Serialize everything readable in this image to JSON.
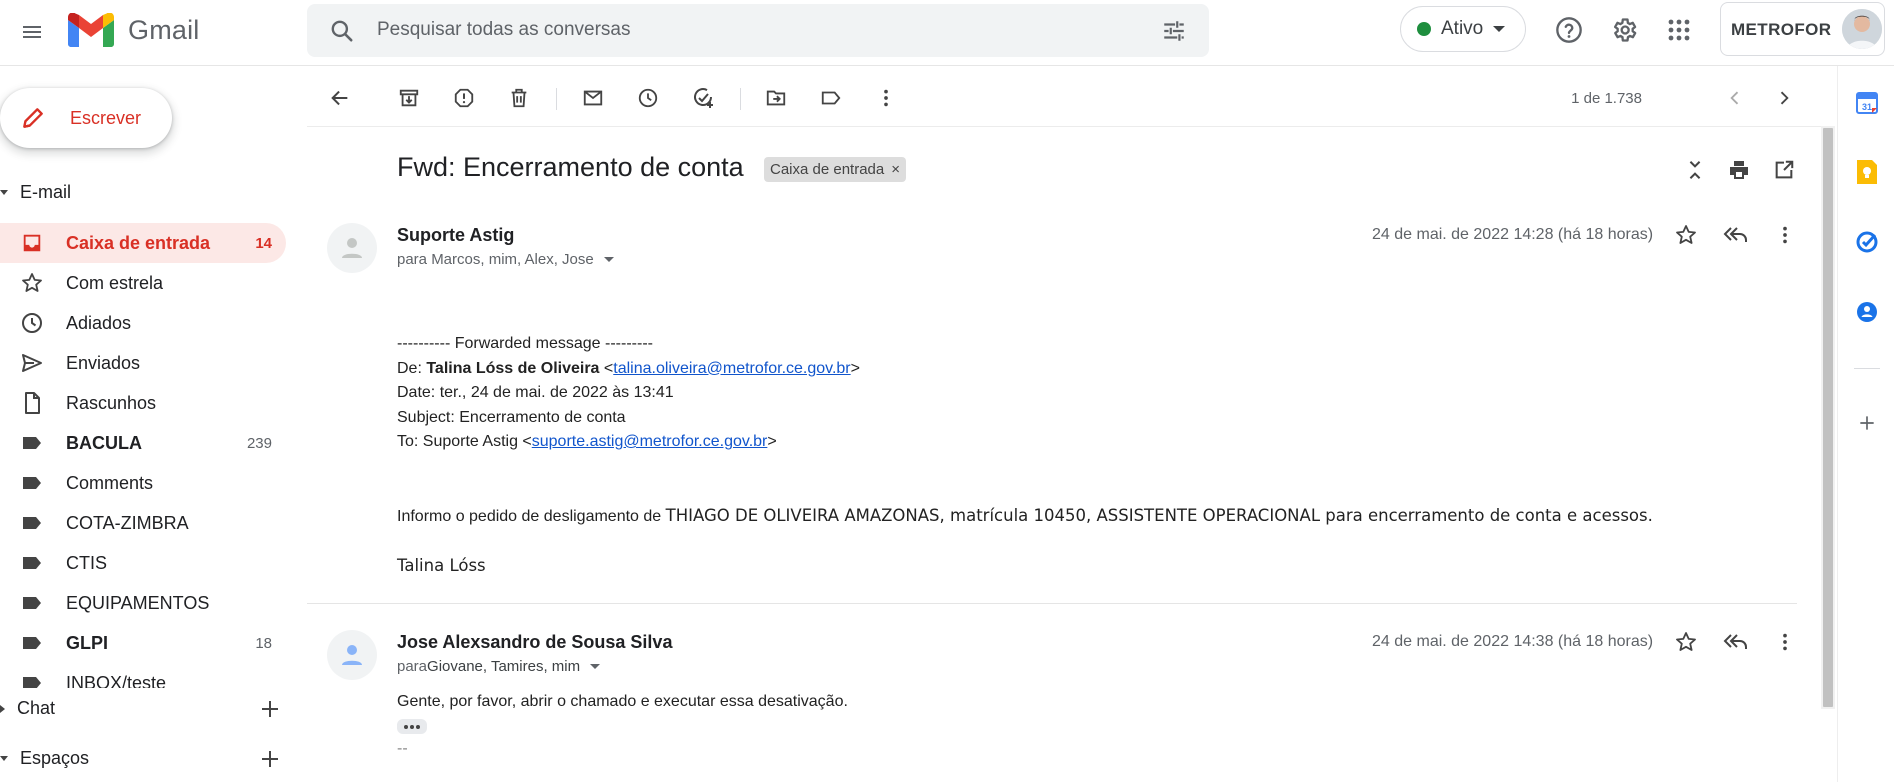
{
  "app": {
    "name": "Gmail"
  },
  "search": {
    "placeholder": "Pesquisar todas as conversas"
  },
  "status": {
    "label": "Ativo",
    "color": "#1e8e3e"
  },
  "account": {
    "brand": "METROFOR"
  },
  "compose": {
    "label": "Escrever"
  },
  "sidebar": {
    "mail_section": "E-mail",
    "items": [
      {
        "label": "Caixa de entrada",
        "count": "14",
        "icon": "inbox-icon",
        "active": true
      },
      {
        "label": "Com estrela",
        "count": "",
        "icon": "star-icon"
      },
      {
        "label": "Adiados",
        "count": "",
        "icon": "clock-icon"
      },
      {
        "label": "Enviados",
        "count": "",
        "icon": "send-icon"
      },
      {
        "label": "Rascunhos",
        "count": "",
        "icon": "draft-icon"
      },
      {
        "label": "BACULA",
        "count": "239",
        "icon": "label-icon",
        "bold": true
      },
      {
        "label": "Comments",
        "count": "",
        "icon": "label-icon"
      },
      {
        "label": "COTA-ZIMBRA",
        "count": "",
        "icon": "label-icon"
      },
      {
        "label": "CTIS",
        "count": "",
        "icon": "label-icon"
      },
      {
        "label": "EQUIPAMENTOS",
        "count": "",
        "icon": "label-icon"
      },
      {
        "label": "GLPI",
        "count": "18",
        "icon": "label-icon",
        "bold": true
      },
      {
        "label": "INBOX/teste",
        "count": "",
        "icon": "label-icon"
      }
    ],
    "chat_section": "Chat",
    "spaces_section": "Espaços"
  },
  "toolbar": {
    "pager": "1 de 1.738"
  },
  "thread": {
    "subject": "Fwd: Encerramento de conta",
    "label_chip": "Caixa de entrada",
    "label_chip_close": "×",
    "messages": [
      {
        "sender": "Suporte Astig",
        "recipients": "para Marcos, mim, Alex, Jose",
        "date": "24 de mai. de 2022 14:28 (há 18 horas)",
        "fwd_header": "---------- Forwarded message ---------",
        "from_label": "De: ",
        "from_name": "Talina Lóss de Oliveira",
        "from_email": "talina.oliveira@metrofor.ce.gov.br",
        "date_line": "Date: ter., 24 de mai. de 2022 às 13:41",
        "subject_line": "Subject: Encerramento de conta",
        "to_label": "To: Suporte Astig <",
        "to_email": "suporte.astig@metrofor.ce.gov.br",
        "body_intro": "Informo o pedido de desligamento de ",
        "body_main": "THIAGO DE OLIVEIRA AMAZONAS, matrícula 10450, ASSISTENTE OPERACIONAL para encerramento de conta e acessos.",
        "signature": "Talina Lóss"
      },
      {
        "sender": "Jose Alexsandro de Sousa Silva",
        "recipients_prefix": "para ",
        "recipients_names": "Giovane, Tamires, mim",
        "date": "24 de mai. de 2022 14:38 (há 18 horas)",
        "body": "Gente, por favor, abrir o chamado e executar essa desativação.",
        "sig_dash": "--"
      }
    ]
  },
  "colors": {
    "accent": "#d93025",
    "link": "#1155cc",
    "active_bg": "#fce8e6"
  }
}
